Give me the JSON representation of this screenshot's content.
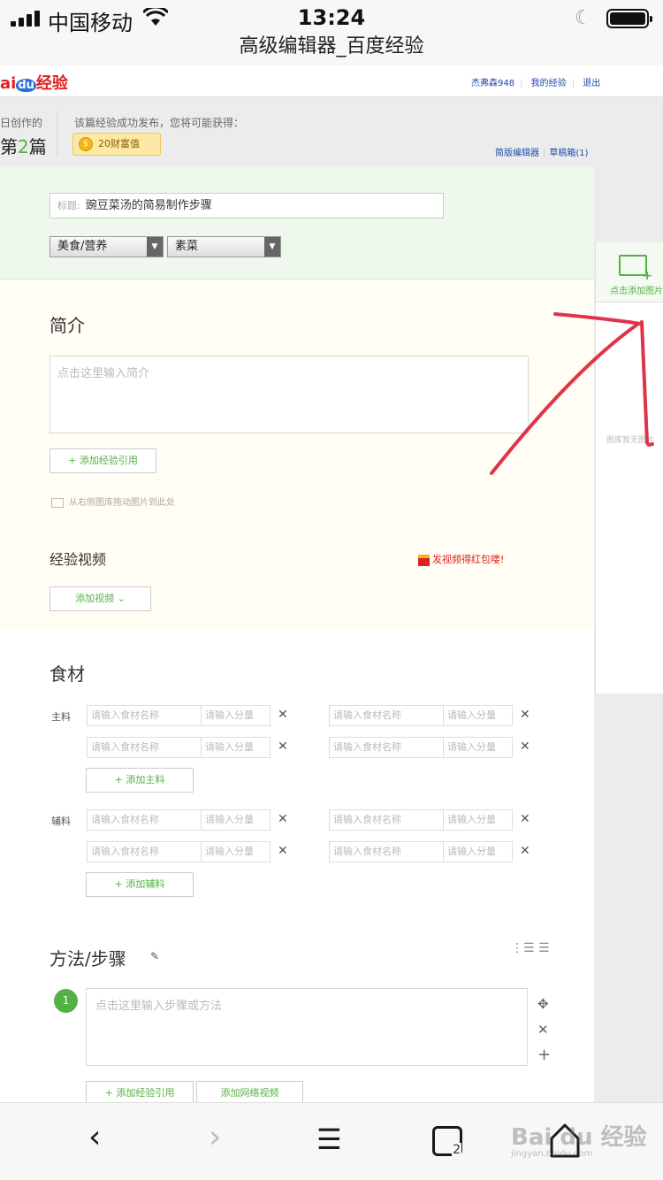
{
  "status": {
    "carrier": "中国移动",
    "time": "13:24"
  },
  "page_title": "高级编辑器_百度经验",
  "header": {
    "logo_b": "ai",
    "logo_du": "du",
    "logo_jy": "经验",
    "user": "杰弗森948",
    "my_exp": "我的经验",
    "logout": "退出"
  },
  "banner": {
    "today_label": "日创作的",
    "today_prefix": "第",
    "today_num": "2",
    "today_suffix": "篇",
    "earn_label": "该篇经验成功发布，您将可能获得：",
    "coin_text": "20财富值",
    "simple_editor": "简版编辑器",
    "drafts": "草稿箱(1)"
  },
  "title_section": {
    "label": "标题:",
    "value": "豌豆菜汤的简易制作步骤",
    "category1": "美食/营养",
    "category2": "素菜"
  },
  "intro": {
    "heading": "简介",
    "placeholder": "点击这里输入简介",
    "add_ref": "+ 添加经验引用",
    "drag_hint": "从右侧图库拖动图片到此处",
    "video_heading": "经验视频",
    "red_packet": "发视频得红包喽!",
    "add_video": "添加视频 ⌄"
  },
  "ingredients": {
    "heading": "食材",
    "main_label": "主料",
    "aux_label": "辅料",
    "name_placeholder": "请输入食材名称",
    "amount_placeholder": "请输入分量",
    "add_main": "+ 添加主料",
    "add_aux": "+ 添加辅料"
  },
  "steps": {
    "heading": "方法/步骤",
    "number": "1",
    "placeholder": "点击这里输入步骤或方法",
    "add_ref": "+ 添加经验引用",
    "add_web_video": "添加网络视频"
  },
  "right_panel": {
    "add_image": "点击添加图片",
    "gallery_empty": "图库暂无图片"
  },
  "watermark": {
    "main": "Bai du 经验",
    "sub": "jingyan.baidu.com"
  },
  "colors": {
    "accent_green": "#54b144",
    "annotation_red": "#e0334a",
    "link_blue": "#1f4aa8"
  }
}
